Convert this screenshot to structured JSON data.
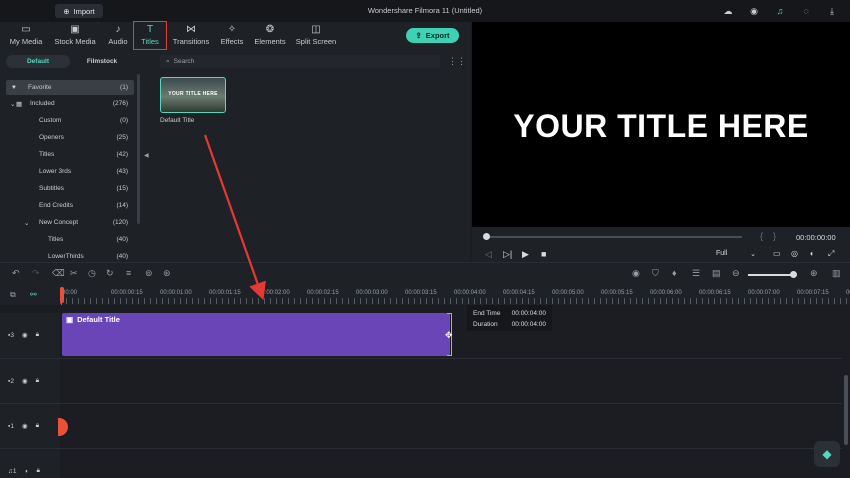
{
  "titlebar": {
    "import_label": "Import",
    "app_title": "Wondershare Filmora 11 (Untitled)"
  },
  "media_tabs": [
    {
      "label": "My Media",
      "icon": "folder-icon"
    },
    {
      "label": "Stock Media",
      "icon": "image-icon"
    },
    {
      "label": "Audio",
      "icon": "music-icon"
    },
    {
      "label": "Titles",
      "icon": "text-icon"
    },
    {
      "label": "Transitions",
      "icon": "transition-icon"
    },
    {
      "label": "Effects",
      "icon": "sparkle-icon"
    },
    {
      "label": "Elements",
      "icon": "elements-icon"
    },
    {
      "label": "Split Screen",
      "icon": "split-screen-icon"
    }
  ],
  "export_label": "Export",
  "sidebar": {
    "tabs": [
      "Default",
      "Filmstock"
    ],
    "items": [
      {
        "label": "Favorite",
        "count": "(1)"
      },
      {
        "label": "Included",
        "count": "(276)"
      },
      {
        "label": "Custom",
        "count": "(0)"
      },
      {
        "label": "Openers",
        "count": "(25)"
      },
      {
        "label": "Titles",
        "count": "(42)"
      },
      {
        "label": "Lower 3rds",
        "count": "(43)"
      },
      {
        "label": "Subtitles",
        "count": "(15)"
      },
      {
        "label": "End Credits",
        "count": "(14)"
      },
      {
        "label": "New Concept",
        "count": "(120)"
      },
      {
        "label": "Titles",
        "count": "(40)"
      },
      {
        "label": "LowerThirds",
        "count": "(40)"
      }
    ]
  },
  "search": {
    "placeholder": "Search"
  },
  "thumbnail": {
    "text": "YOUR TITLE HERE",
    "label": "Default Title"
  },
  "preview": {
    "title_text": "YOUR TITLE HERE",
    "timecode": "00:00:00:00",
    "quality": "Full"
  },
  "ruler_labels": [
    "00:00",
    "00:00:00:15",
    "00:00:01:00",
    "00:00:01:15",
    "00:00:02:00",
    "00:00:02:15",
    "00:00:03:00",
    "00:00:03:15",
    "00:00:04:00",
    "00:00:04:15",
    "00:00:05:00",
    "00:00:05:15",
    "00:00:06:00",
    "00:00:06:15",
    "00:00:07:00",
    "00:00:07:15",
    "00:00:0"
  ],
  "tracks": [
    {
      "label": "3"
    },
    {
      "label": "2"
    },
    {
      "label": "1"
    },
    {
      "label": "1"
    }
  ],
  "clip": {
    "label": "Default Title"
  },
  "tooltip": {
    "end_time_label": "End Time",
    "end_time_value": "00:00:04:00",
    "duration_label": "Duration",
    "duration_value": "00:00:04:00"
  },
  "colors": {
    "accent": "#3fd1b3",
    "clip": "#6a45b8",
    "playhead": "#e8503a",
    "highlight": "#e53935"
  }
}
